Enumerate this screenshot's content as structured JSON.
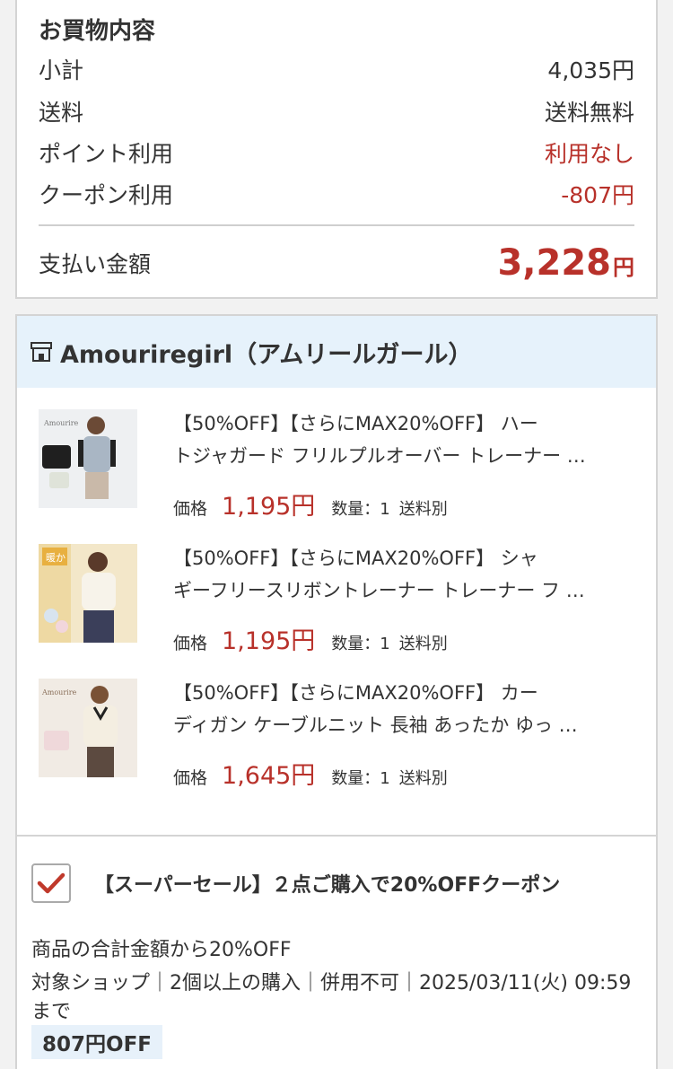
{
  "summary": {
    "title": "お買物内容",
    "rows": [
      {
        "label": "小計",
        "value": "4,035円"
      },
      {
        "label": "送料",
        "value": "送料無料"
      },
      {
        "label": "ポイント利用",
        "value": "利用なし"
      },
      {
        "label": "クーポン利用",
        "value": "-807円"
      }
    ],
    "total_label": "支払い金額",
    "total_amount": "3,228",
    "total_unit": "円",
    "accent_color": "#b8312a"
  },
  "shop": {
    "icon": "store-icon",
    "name": "Amouriregirl（アムリールガール）",
    "header_bg": "#e6f2fb",
    "items": [
      {
        "title_line1": "【50%OFF】【さらにMAX20%OFF】 ハー",
        "title_line2": "トジャガード フリルプルオーバー トレーナー …",
        "price_label": "価格",
        "price": "1,195円",
        "quantity": "数量：1",
        "shipping": "送料別"
      },
      {
        "title_line1": "【50%OFF】【さらにMAX20%OFF】 シャ",
        "title_line2": "ギーフリースリボントレーナー トレーナー フ …",
        "price_label": "価格",
        "price": "1,195円",
        "quantity": "数量：1",
        "shipping": "送料別"
      },
      {
        "title_line1": "【50%OFF】【さらにMAX20%OFF】 カー",
        "title_line2": "ディガン ケーブルニット 長袖 あったか ゆっ …",
        "price_label": "価格",
        "price": "1,645円",
        "quantity": "数量：1",
        "shipping": "送料別"
      }
    ]
  },
  "coupon": {
    "checked": true,
    "title": "【スーパーセール】２点ご購入で20%OFFクーポン",
    "description": "商品の合計金額から20%OFF",
    "conditions": "対象ショップ｜2個以上の購入｜併用不可｜2025/03/11(火) 09:59まで",
    "badge": "807円OFF"
  }
}
